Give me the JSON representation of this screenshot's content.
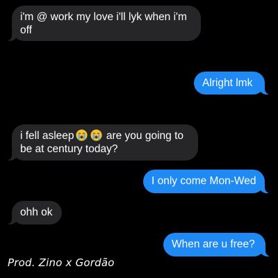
{
  "messages": [
    {
      "direction": "incoming",
      "text": "i'm @ work my love i'll lyk when i'm off"
    },
    {
      "direction": "outgoing",
      "text": "Alright lmk"
    },
    {
      "direction": "incoming",
      "text_before": "i fell asleep",
      "emoji": [
        "loudly-crying-face",
        "loudly-crying-face"
      ],
      "text_after": " are you going to be at century today?"
    },
    {
      "direction": "outgoing",
      "text": "I only come Mon-Wed"
    },
    {
      "direction": "incoming",
      "text": "ohh ok"
    },
    {
      "direction": "outgoing",
      "text": "When are u free?"
    }
  ],
  "credit": "Prod. Zino x Gordão",
  "colors": {
    "background": "#000000",
    "incoming_bubble": "#262628",
    "outgoing_bubble": "#1f8af4",
    "text": "#ffffff"
  }
}
